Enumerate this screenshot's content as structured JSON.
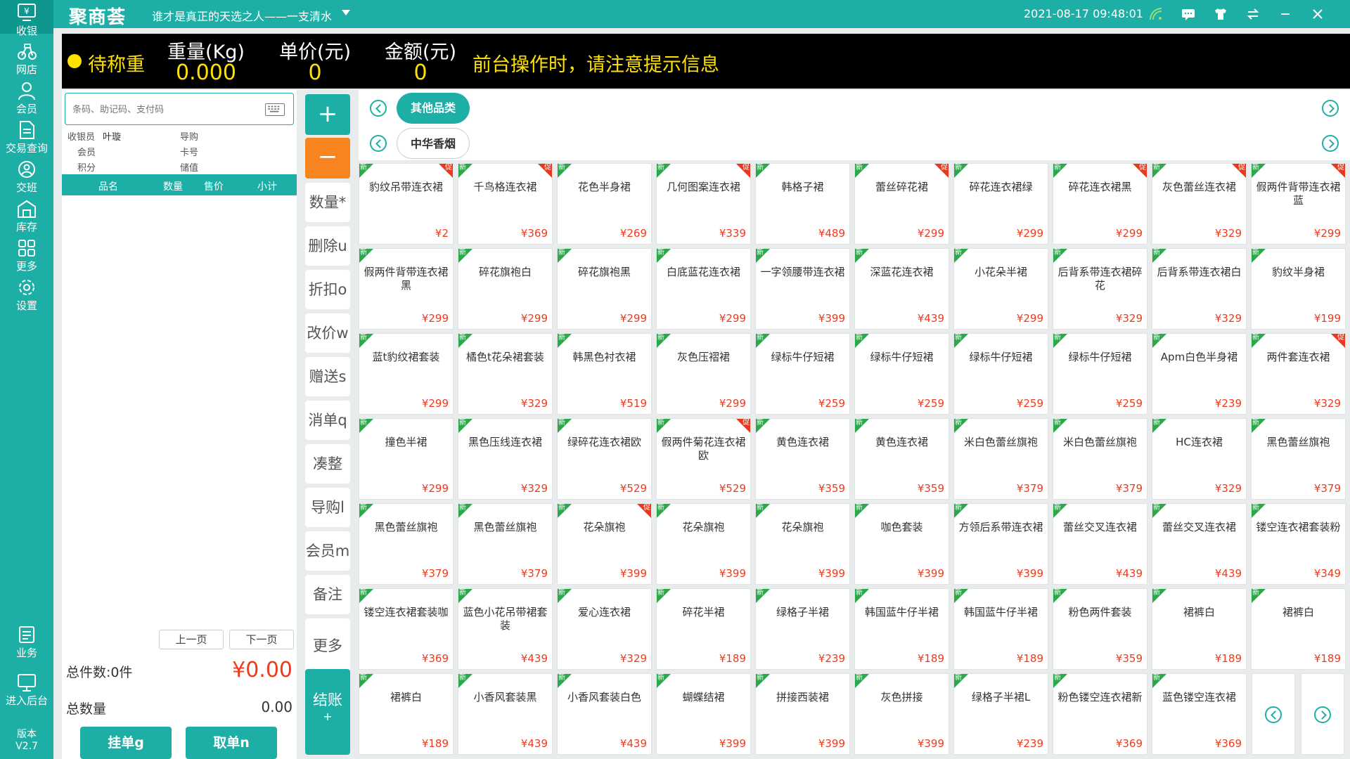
{
  "nav": {
    "items": [
      {
        "label": "收银",
        "icon": "cashier-icon"
      },
      {
        "label": "网店",
        "icon": "bike-icon"
      },
      {
        "label": "会员",
        "icon": "user-icon"
      },
      {
        "label": "交易查询",
        "icon": "document-icon"
      },
      {
        "label": "交班",
        "icon": "handover-icon"
      },
      {
        "label": "库存",
        "icon": "warehouse-icon"
      },
      {
        "label": "更多",
        "icon": "grid-icon"
      },
      {
        "label": "设置",
        "icon": "gear-icon"
      }
    ],
    "bottom": [
      {
        "label": "业务",
        "icon": "clipboard-icon"
      },
      {
        "label": "进入后台",
        "icon": "monitor-icon"
      }
    ],
    "version_label": "版本",
    "version": "V2.7"
  },
  "topbar": {
    "logo": "聚商荟",
    "slogan": "谁才是真正的天选之人——一支清水",
    "datetime": "2021-08-17 09:48:01",
    "accent": "#1dafa6"
  },
  "scale": {
    "status": "待称重",
    "weight_label": "重量(Kg)",
    "weight": "0.000",
    "unit_price_label": "单价(元)",
    "unit_price": "0",
    "amount_label": "金额(元)",
    "amount": "0",
    "message": "前台操作时，请注意提示信息"
  },
  "order": {
    "search_placeholder": "条码、助记码、支付码",
    "cashier_label": "收银员",
    "cashier": "叶璇",
    "guide_label": "导购",
    "member_label": "会员",
    "card_label": "卡号",
    "points_label": "积分",
    "balance_label": "储值",
    "columns": [
      "品名",
      "数量",
      "售价",
      "小计"
    ],
    "prev_page": "上一页",
    "next_page": "下一页",
    "total_count_label": "总件数:0件",
    "total_amount": "¥0.00",
    "total_qty_label": "总数量",
    "total_qty": "0.00",
    "hold_button": "挂单g",
    "retrieve_button": "取单n"
  },
  "actions": {
    "add": "+",
    "minus": "−",
    "buttons": [
      "数量*",
      "删除u",
      "折扣o",
      "改价w",
      "赠送s",
      "消单q",
      "凑整",
      "导购l",
      "会员m",
      "备注",
      "更多"
    ],
    "checkout": "结账",
    "checkout_sub": "+"
  },
  "categories": [
    {
      "label": "其他品类",
      "active": true
    },
    {
      "label": "中华香烟",
      "active": false
    }
  ],
  "tags": {
    "new": "新",
    "promo": "促"
  },
  "products": [
    {
      "name": "豹纹吊带连衣裙",
      "price": "¥2",
      "promo": true
    },
    {
      "name": "千鸟格连衣裙",
      "price": "¥369",
      "promo": true
    },
    {
      "name": "花色半身裙",
      "price": "¥269",
      "promo": false
    },
    {
      "name": "几何图案连衣裙",
      "price": "¥339",
      "promo": true
    },
    {
      "name": "韩格子裙",
      "price": "¥489",
      "promo": false
    },
    {
      "name": "蕾丝碎花裙",
      "price": "¥299",
      "promo": true
    },
    {
      "name": "碎花连衣裙绿",
      "price": "¥299",
      "promo": false
    },
    {
      "name": "碎花连衣裙黑",
      "price": "¥299",
      "promo": true
    },
    {
      "name": "灰色蕾丝连衣裙",
      "price": "¥329",
      "promo": true
    },
    {
      "name": "假两件背带连衣裙蓝",
      "price": "¥299",
      "promo": true
    },
    {
      "name": "假两件背带连衣裙黑",
      "price": "¥299",
      "promo": false
    },
    {
      "name": "碎花旗袍白",
      "price": "¥299",
      "promo": false
    },
    {
      "name": "碎花旗袍黑",
      "price": "¥299",
      "promo": false
    },
    {
      "name": "白底蓝花连衣裙",
      "price": "¥299",
      "promo": false
    },
    {
      "name": "一字领腰带连衣裙",
      "price": "¥399",
      "promo": false
    },
    {
      "name": "深蓝花连衣裙",
      "price": "¥439",
      "promo": false
    },
    {
      "name": "小花朵半裙",
      "price": "¥299",
      "promo": false
    },
    {
      "name": "后背系带连衣裙碎花",
      "price": "¥329",
      "promo": false
    },
    {
      "name": "后背系带连衣裙白",
      "price": "¥329",
      "promo": false
    },
    {
      "name": "豹纹半身裙",
      "price": "¥199",
      "promo": false
    },
    {
      "name": "蓝t豹纹裙套装",
      "price": "¥299",
      "promo": false
    },
    {
      "name": "橘色t花朵裙套装",
      "price": "¥329",
      "promo": false
    },
    {
      "name": "韩黑色衬衣裙",
      "price": "¥519",
      "promo": false
    },
    {
      "name": "灰色压褶裙",
      "price": "¥299",
      "promo": false
    },
    {
      "name": "绿标牛仔短裙",
      "price": "¥259",
      "promo": false
    },
    {
      "name": "绿标牛仔短裙",
      "price": "¥259",
      "promo": false
    },
    {
      "name": "绿标牛仔短裙",
      "price": "¥259",
      "promo": false
    },
    {
      "name": "绿标牛仔短裙",
      "price": "¥259",
      "promo": false
    },
    {
      "name": "Apm白色半身裙",
      "price": "¥239",
      "promo": false
    },
    {
      "name": "两件套连衣裙",
      "price": "¥329",
      "promo": true
    },
    {
      "name": "撞色半裙",
      "price": "¥299",
      "promo": false
    },
    {
      "name": "黑色压线连衣裙",
      "price": "¥329",
      "promo": false
    },
    {
      "name": "绿碎花连衣裙欧",
      "price": "¥529",
      "promo": false
    },
    {
      "name": "假两件菊花连衣裙欧",
      "price": "¥529",
      "promo": true
    },
    {
      "name": "黄色连衣裙",
      "price": "¥359",
      "promo": false
    },
    {
      "name": "黄色连衣裙",
      "price": "¥359",
      "promo": false
    },
    {
      "name": "米白色蕾丝旗袍",
      "price": "¥379",
      "promo": false
    },
    {
      "name": "米白色蕾丝旗袍",
      "price": "¥379",
      "promo": false
    },
    {
      "name": "HC连衣裙",
      "price": "¥329",
      "promo": false
    },
    {
      "name": "黑色蕾丝旗袍",
      "price": "¥379",
      "promo": false
    },
    {
      "name": "黑色蕾丝旗袍",
      "price": "¥379",
      "promo": false
    },
    {
      "name": "黑色蕾丝旗袍",
      "price": "¥379",
      "promo": false
    },
    {
      "name": "花朵旗袍",
      "price": "¥399",
      "promo": true
    },
    {
      "name": "花朵旗袍",
      "price": "¥399",
      "promo": false
    },
    {
      "name": "花朵旗袍",
      "price": "¥399",
      "promo": false
    },
    {
      "name": "咖色套装",
      "price": "¥399",
      "promo": false
    },
    {
      "name": "方领后系带连衣裙",
      "price": "¥399",
      "promo": false
    },
    {
      "name": "蕾丝交叉连衣裙",
      "price": "¥439",
      "promo": false
    },
    {
      "name": "蕾丝交叉连衣裙",
      "price": "¥439",
      "promo": false
    },
    {
      "name": "镂空连衣裙套装粉",
      "price": "¥349",
      "promo": false
    },
    {
      "name": "镂空连衣裙套装咖",
      "price": "¥369",
      "promo": false
    },
    {
      "name": "蓝色小花吊带裙套装",
      "price": "¥439",
      "promo": false
    },
    {
      "name": "爱心连衣裙",
      "price": "¥329",
      "promo": false
    },
    {
      "name": "碎花半裙",
      "price": "¥189",
      "promo": false
    },
    {
      "name": "绿格子半裙",
      "price": "¥239",
      "promo": false
    },
    {
      "name": "韩国蓝牛仔半裙",
      "price": "¥189",
      "promo": false
    },
    {
      "name": "韩国蓝牛仔半裙",
      "price": "¥189",
      "promo": false
    },
    {
      "name": "粉色两件套装",
      "price": "¥359",
      "promo": false
    },
    {
      "name": "裙裤白",
      "price": "¥189",
      "promo": false
    },
    {
      "name": "裙裤白",
      "price": "¥189",
      "promo": false
    },
    {
      "name": "裙裤白",
      "price": "¥189",
      "promo": false
    },
    {
      "name": "小香风套装黑",
      "price": "¥439",
      "promo": false
    },
    {
      "name": "小香风套装白色",
      "price": "¥439",
      "promo": false
    },
    {
      "name": "蝴蝶结裙",
      "price": "¥399",
      "promo": false
    },
    {
      "name": "拼接西装裙",
      "price": "¥399",
      "promo": false
    },
    {
      "name": "灰色拼接",
      "price": "¥399",
      "promo": false
    },
    {
      "name": "绿格子半裙L",
      "price": "¥239",
      "promo": false
    },
    {
      "name": "粉色镂空连衣裙新",
      "price": "¥369",
      "promo": false
    },
    {
      "name": "蓝色镂空连衣裙",
      "price": "¥369",
      "promo": false
    }
  ]
}
